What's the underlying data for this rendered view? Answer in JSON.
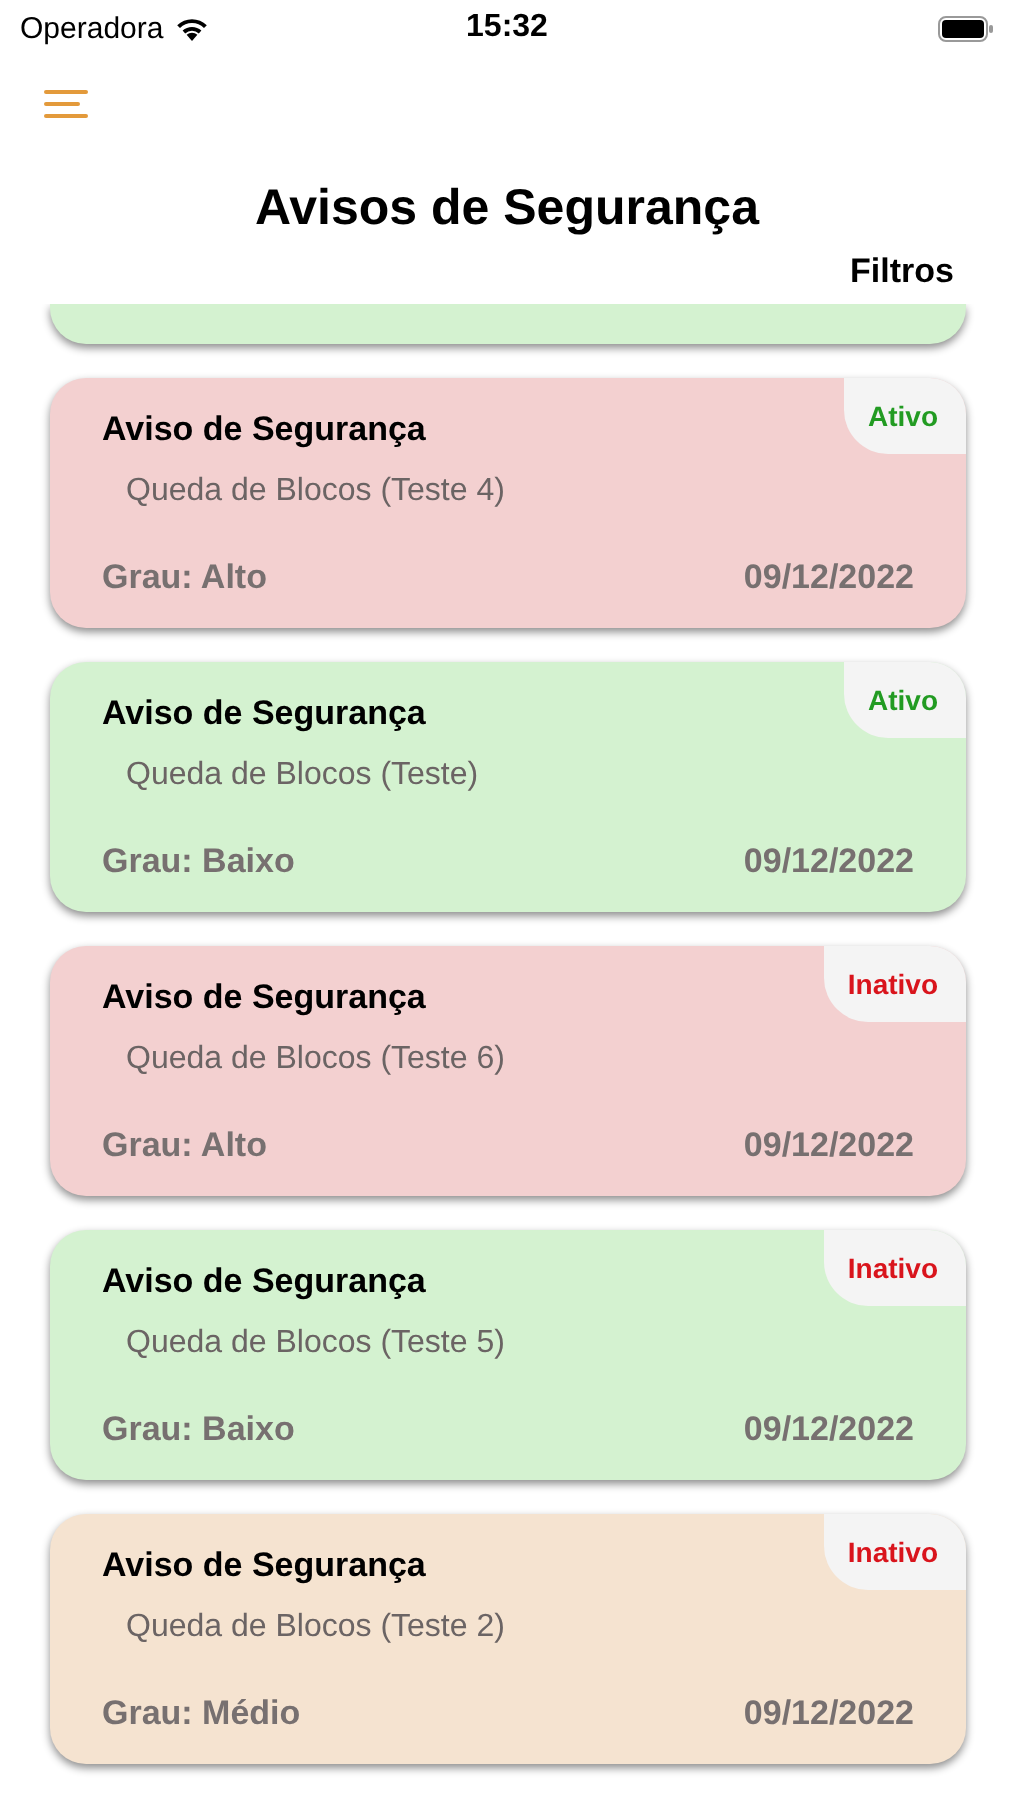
{
  "status_bar": {
    "carrier": "Operadora",
    "time": "15:32"
  },
  "header": {
    "title": "Avisos de Segurança",
    "filter_button": "Filtros"
  },
  "partial_card": {
    "color": "#d4f2d0"
  },
  "cards": [
    {
      "title": "Aviso de Segurança",
      "description": "Queda de Blocos (Teste 4)",
      "grade": "Grau: Alto",
      "date": "09/12/2022",
      "status": "Ativo",
      "active": true,
      "color": "#f3d0d0"
    },
    {
      "title": "Aviso de Segurança",
      "description": "Queda de Blocos (Teste)",
      "grade": "Grau: Baixo",
      "date": "09/12/2022",
      "status": "Ativo",
      "active": true,
      "color": "#d4f2d0"
    },
    {
      "title": "Aviso de Segurança",
      "description": "Queda de Blocos (Teste 6)",
      "grade": "Grau: Alto",
      "date": "09/12/2022",
      "status": "Inativo",
      "active": false,
      "color": "#f3d0d0"
    },
    {
      "title": "Aviso de Segurança",
      "description": "Queda de Blocos (Teste 5)",
      "grade": "Grau: Baixo",
      "date": "09/12/2022",
      "status": "Inativo",
      "active": false,
      "color": "#d4f2d0"
    },
    {
      "title": "Aviso de Segurança",
      "description": "Queda de Blocos (Teste 2)",
      "grade": "Grau: Médio",
      "date": "09/12/2022",
      "status": "Inativo",
      "active": false,
      "color": "#f5e3d0"
    }
  ]
}
